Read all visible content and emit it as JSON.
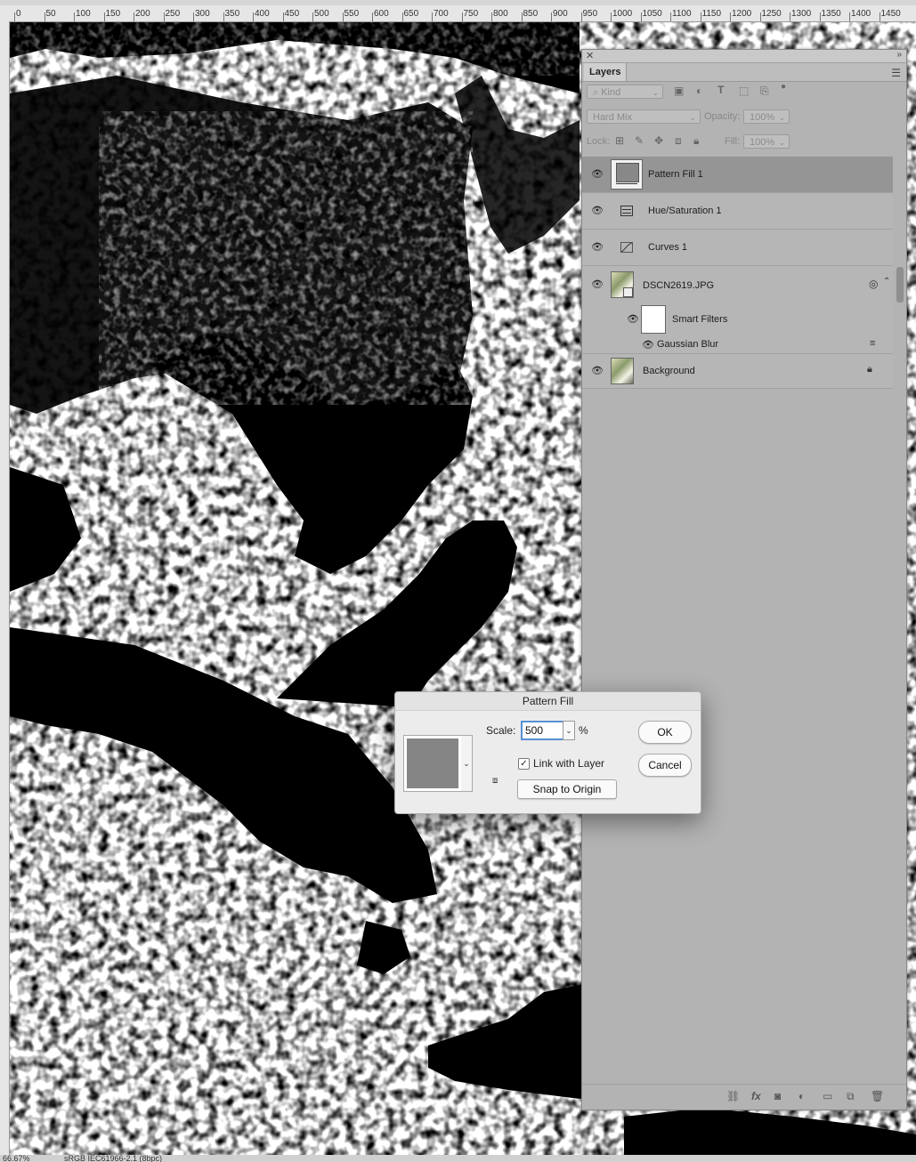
{
  "ruler": {
    "ticks": [
      "0",
      "50",
      "100",
      "150",
      "200",
      "250",
      "300",
      "350",
      "400",
      "450",
      "500",
      "550",
      "600",
      "650",
      "700",
      "750",
      "800",
      "850",
      "900",
      "950",
      "1000",
      "1050",
      "1100",
      "1150",
      "1200",
      "1250",
      "1300",
      "1350",
      "1400",
      "1450"
    ]
  },
  "status": {
    "zoom": "66.67%",
    "profile": "sRGB IEC61966-2.1 (8bpc)"
  },
  "layers_panel": {
    "tab": "Layers",
    "filter_kind": "Kind",
    "blend_mode": "Hard Mix",
    "opacity_label": "Opacity:",
    "opacity_value": "100%",
    "lock_label": "Lock:",
    "fill_label": "Fill:",
    "fill_value": "100%",
    "layers": [
      {
        "name": "Pattern Fill 1",
        "selected": true
      },
      {
        "name": "Hue/Saturation 1",
        "selected": false
      },
      {
        "name": "Curves 1",
        "selected": false
      },
      {
        "name": "DSCN2619.JPG",
        "selected": false
      },
      {
        "name": "Smart Filters",
        "selected": false
      },
      {
        "name": "Gaussian Blur",
        "selected": false
      },
      {
        "name": "Background",
        "selected": false
      }
    ]
  },
  "dialog": {
    "title": "Pattern Fill",
    "scale_label": "Scale:",
    "scale_value": "500",
    "percent": "%",
    "link_with_layer_label": "Link with Layer",
    "link_with_layer_checked": true,
    "snap_button": "Snap to Origin",
    "ok_button": "OK",
    "cancel_button": "Cancel"
  },
  "colors": {
    "canvas_black": "#000000",
    "canvas_white": "#ffffff",
    "panel_bg": "#b3b3b3",
    "selected_layer": "#959595",
    "dialog_bg": "#ececec",
    "focus_ring": "#5a8fd6",
    "pattern_swatch": "#858585"
  }
}
